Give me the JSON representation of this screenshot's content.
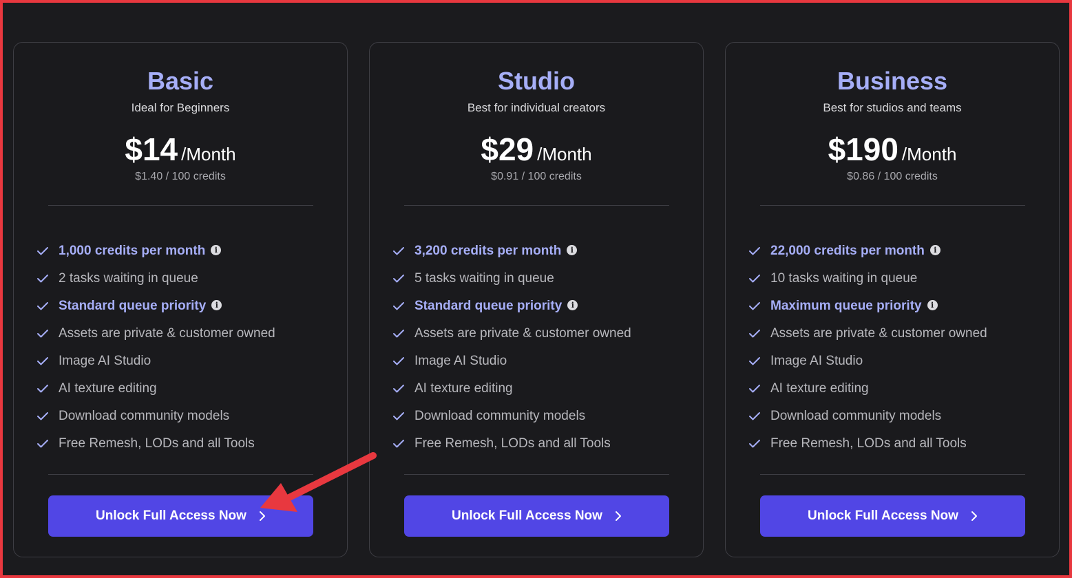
{
  "colors": {
    "accent": "#a6aef7",
    "button": "#5146e5",
    "background": "#1b1b1e",
    "border": "#3e3e44",
    "annotation": "#e8383f"
  },
  "plans": [
    {
      "name": "Basic",
      "tagline": "Ideal for Beginners",
      "price": "$14",
      "period": "/Month",
      "unit_cost": "$1.40 / 100 credits",
      "features": [
        {
          "text": "1,000 credits per month",
          "highlight": true,
          "info": true
        },
        {
          "text": "2 tasks waiting in queue",
          "highlight": false,
          "info": false
        },
        {
          "text": "Standard queue priority",
          "highlight": true,
          "info": true
        },
        {
          "text": "Assets are private & customer owned",
          "highlight": false,
          "info": false
        },
        {
          "text": "Image AI Studio",
          "highlight": false,
          "info": false
        },
        {
          "text": "AI texture editing",
          "highlight": false,
          "info": false
        },
        {
          "text": "Download community models",
          "highlight": false,
          "info": false
        },
        {
          "text": "Free Remesh, LODs and all Tools",
          "highlight": false,
          "info": false
        }
      ],
      "cta": "Unlock Full Access Now"
    },
    {
      "name": "Studio",
      "tagline": "Best for individual creators",
      "price": "$29",
      "period": "/Month",
      "unit_cost": "$0.91 / 100 credits",
      "features": [
        {
          "text": "3,200 credits per month",
          "highlight": true,
          "info": true
        },
        {
          "text": "5 tasks waiting in queue",
          "highlight": false,
          "info": false
        },
        {
          "text": "Standard queue priority",
          "highlight": true,
          "info": true
        },
        {
          "text": "Assets are private & customer owned",
          "highlight": false,
          "info": false
        },
        {
          "text": "Image AI Studio",
          "highlight": false,
          "info": false
        },
        {
          "text": "AI texture editing",
          "highlight": false,
          "info": false
        },
        {
          "text": "Download community models",
          "highlight": false,
          "info": false
        },
        {
          "text": "Free Remesh, LODs and all Tools",
          "highlight": false,
          "info": false
        }
      ],
      "cta": "Unlock Full Access Now"
    },
    {
      "name": "Business",
      "tagline": "Best for studios and teams",
      "price": "$190",
      "period": "/Month",
      "unit_cost": "$0.86 / 100 credits",
      "features": [
        {
          "text": "22,000 credits per month",
          "highlight": true,
          "info": true
        },
        {
          "text": "10 tasks waiting in queue",
          "highlight": false,
          "info": false
        },
        {
          "text": "Maximum queue priority",
          "highlight": true,
          "info": true
        },
        {
          "text": "Assets are private & customer owned",
          "highlight": false,
          "info": false
        },
        {
          "text": "Image AI Studio",
          "highlight": false,
          "info": false
        },
        {
          "text": "AI texture editing",
          "highlight": false,
          "info": false
        },
        {
          "text": "Download community models",
          "highlight": false,
          "info": false
        },
        {
          "text": "Free Remesh, LODs and all Tools",
          "highlight": false,
          "info": false
        }
      ],
      "cta": "Unlock Full Access Now"
    }
  ],
  "info_glyph": "i"
}
